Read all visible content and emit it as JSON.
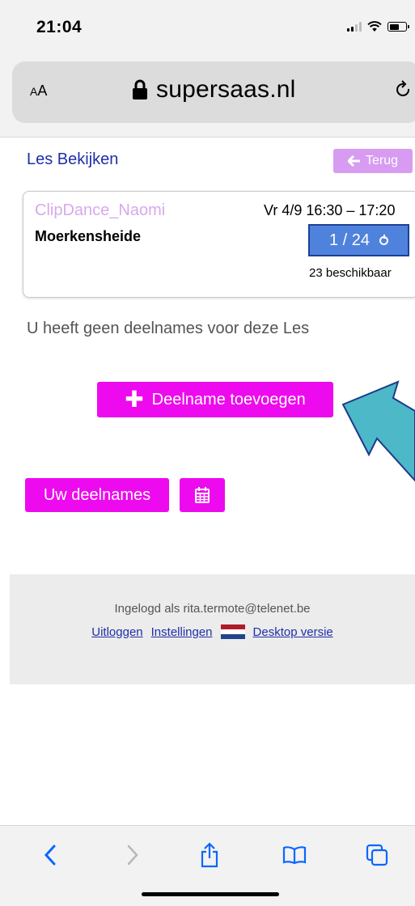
{
  "status_bar": {
    "time": "21:04"
  },
  "browser": {
    "aa_label_small": "A",
    "aa_label_large": "A",
    "url": "supersaas.nl",
    "icons": [
      "lock-icon",
      "reload-icon",
      "back-icon",
      "forward-icon",
      "share-icon",
      "bookmarks-icon",
      "tabs-icon"
    ]
  },
  "page": {
    "title": "Les Bekijken",
    "back_button": "Terug",
    "lesson": {
      "name": "ClipDance_Naomi",
      "location": "Moerkensheide",
      "datetime": "Vr 4/9  16:30 – 17:20",
      "capacity": "1 / 24",
      "available": "23 beschikbaar"
    },
    "no_participation": "U heeft geen deelnames voor deze Les",
    "add_button": "Deelname toevoegen",
    "my_participations_button": "Uw deelnames"
  },
  "footer": {
    "logged_in": "Ingelogd als rita.termote@telenet.be",
    "logout": "Uitloggen",
    "settings": "Instellingen",
    "desktop": "Desktop versie"
  },
  "colors": {
    "accent_magenta": "#ee0aee",
    "link_blue": "#1f2fa7",
    "capacity_blue": "#4f82dc",
    "annotation_arrow": "#4cb8c8"
  }
}
